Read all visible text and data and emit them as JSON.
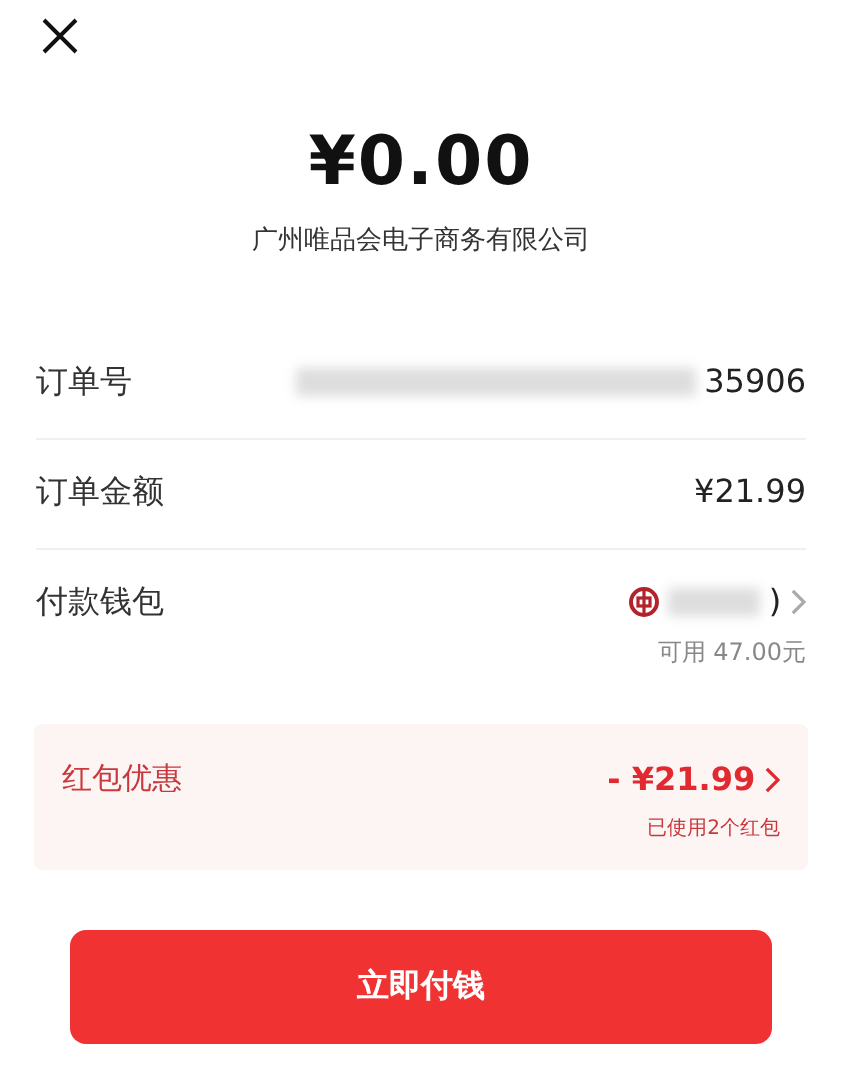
{
  "amount": "¥0.00",
  "merchant": "广州唯品会电子商务有限公司",
  "rows": [
    {
      "kind": "order",
      "label": "订单号",
      "value": "35906"
    },
    {
      "kind": "price",
      "label": "订单金额",
      "value": "¥21.99"
    },
    {
      "kind": "wallet",
      "label": "付款钱包",
      "value": ")",
      "note": "可用 47.00元"
    }
  ],
  "coupon": {
    "label": "红包优惠",
    "value": "- ¥21.99",
    "note": "已使用2个红包"
  },
  "pay_button": "立即付钱"
}
